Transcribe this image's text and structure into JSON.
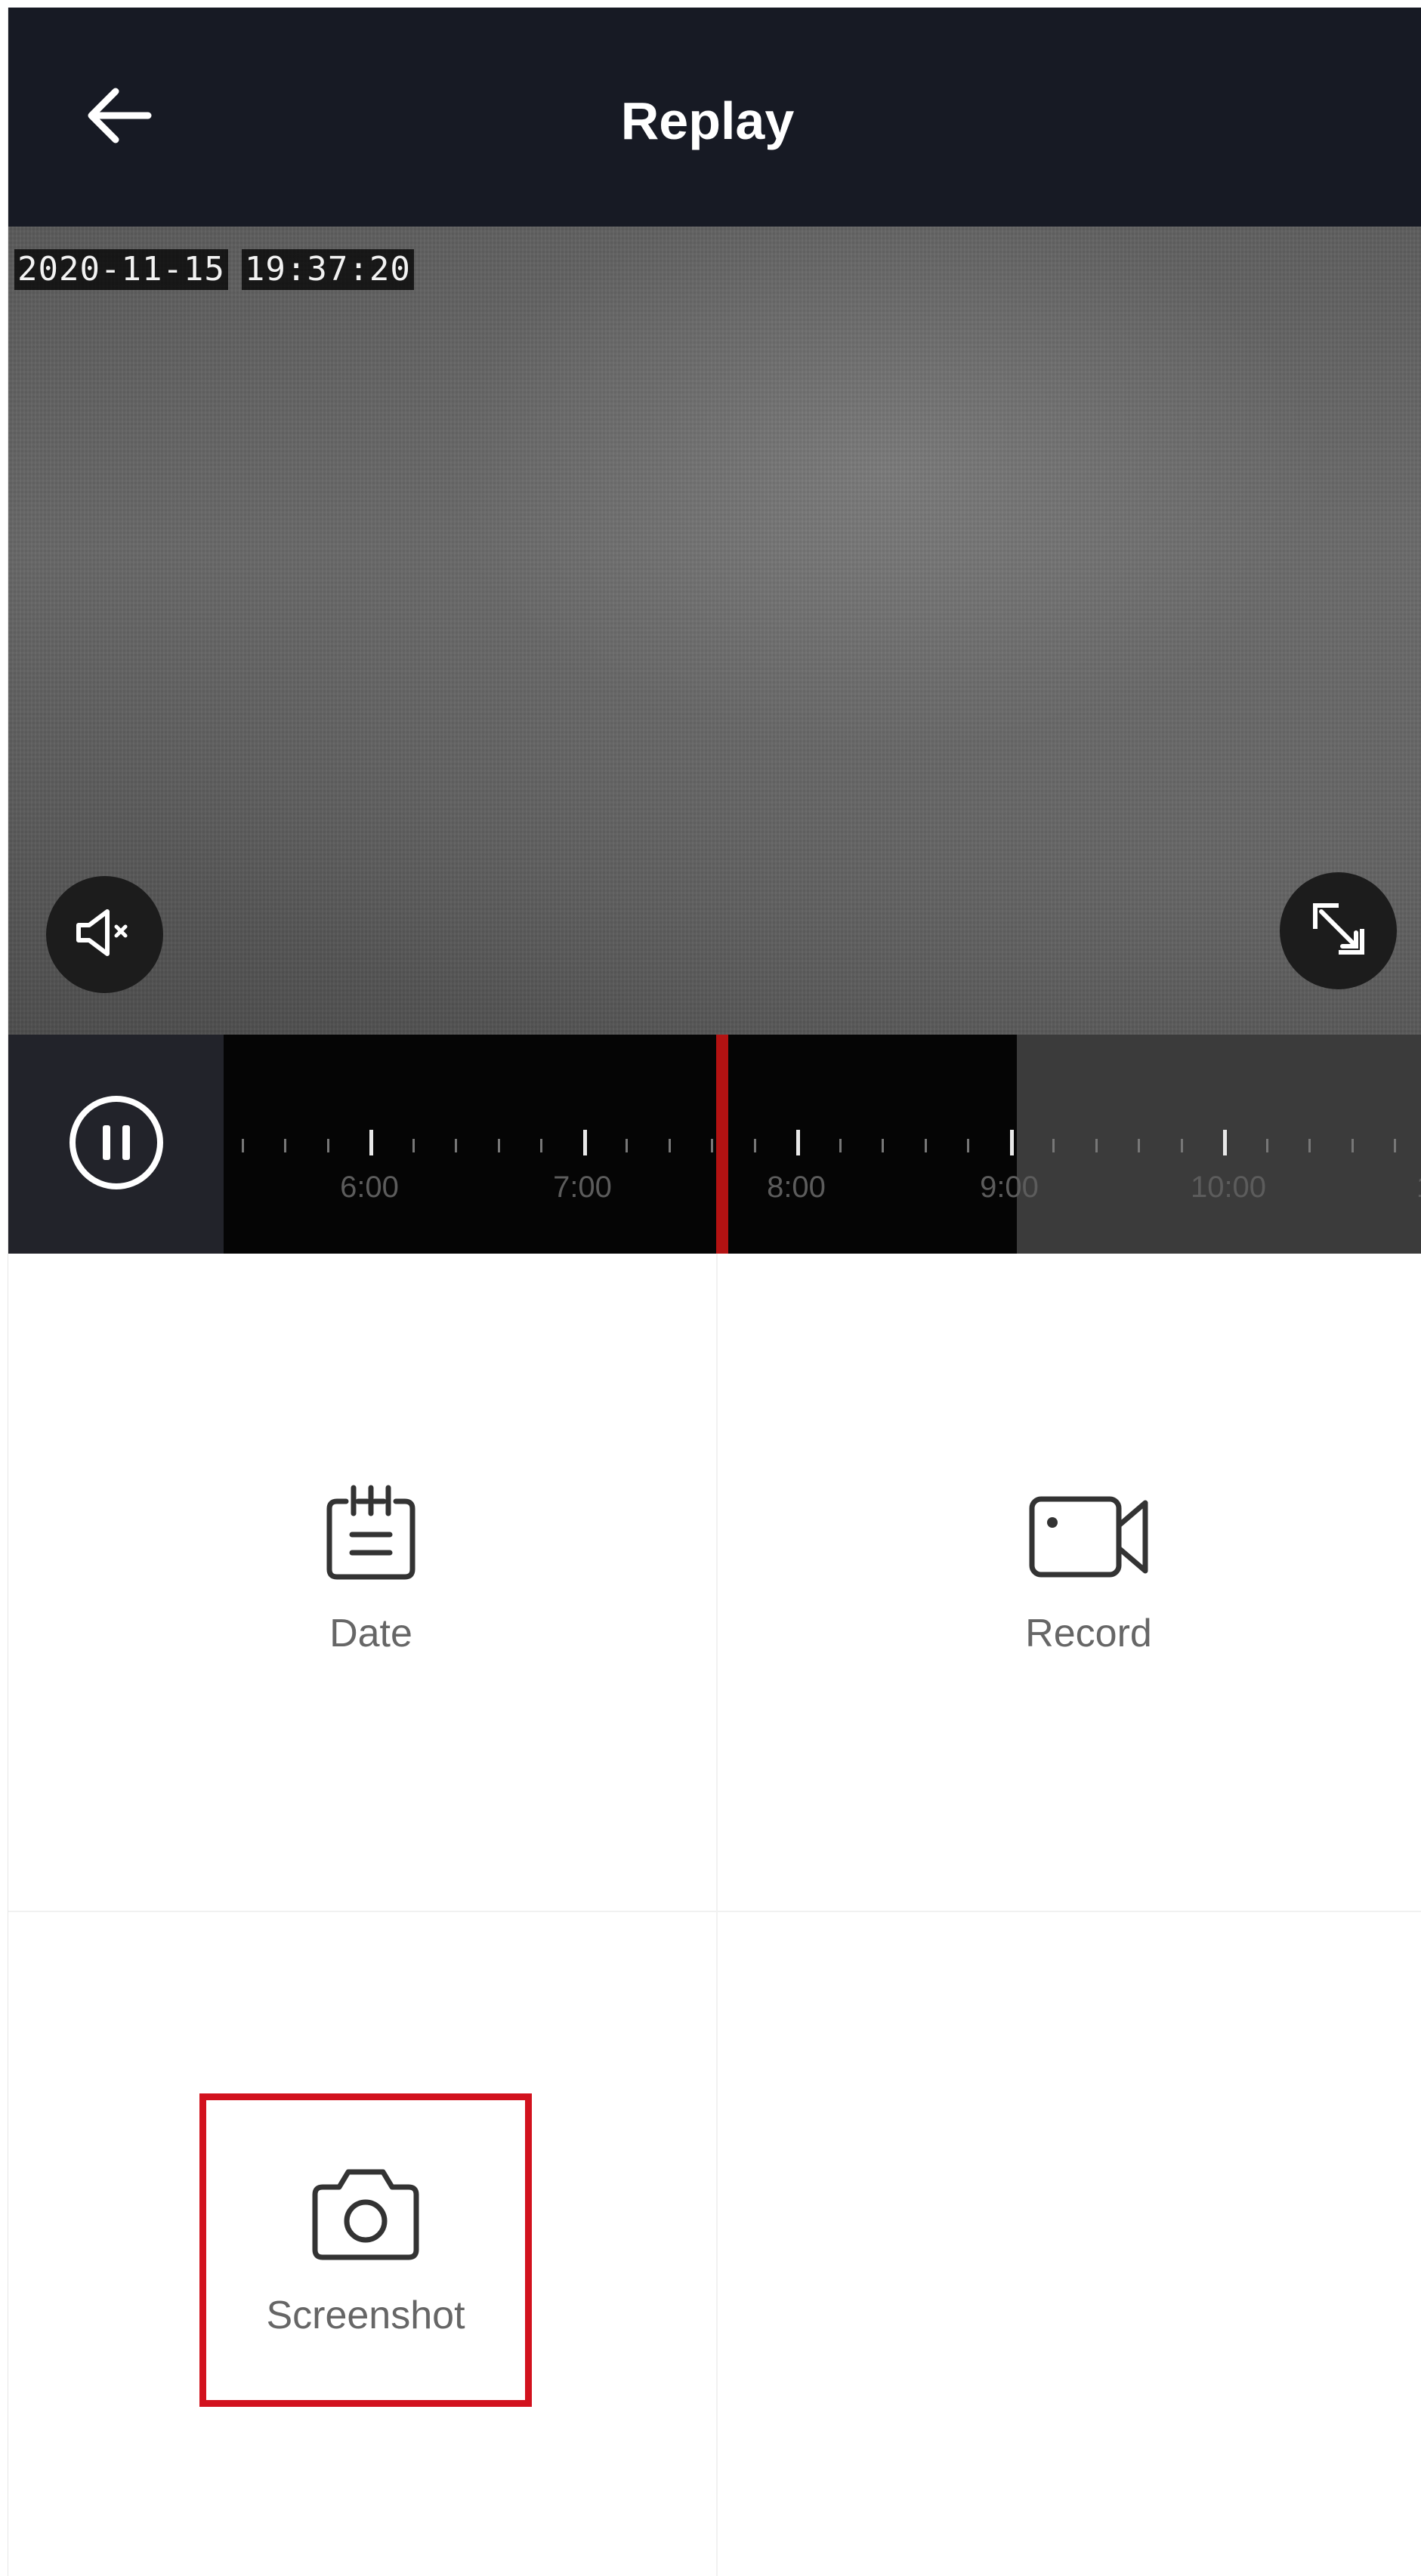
{
  "header": {
    "title": "Replay",
    "back_icon": "arrow-left-icon"
  },
  "video": {
    "date": "2020-11-15",
    "time": "19:37:20",
    "mute_icon": "speaker-muted-icon",
    "fullscreen_icon": "fullscreen-icon"
  },
  "timeline": {
    "pause_icon": "pause-icon",
    "labels": [
      "6:00",
      "7:00",
      "8:00",
      "9:00",
      "10:00",
      "1"
    ],
    "playhead_color": "#b31212"
  },
  "actions": {
    "date_label": "Date",
    "record_label": "Record",
    "screenshot_label": "Screenshot",
    "date_icon": "calendar-icon",
    "record_icon": "video-camera-icon",
    "screenshot_icon": "camera-icon",
    "highlight_color": "#d2121e"
  }
}
